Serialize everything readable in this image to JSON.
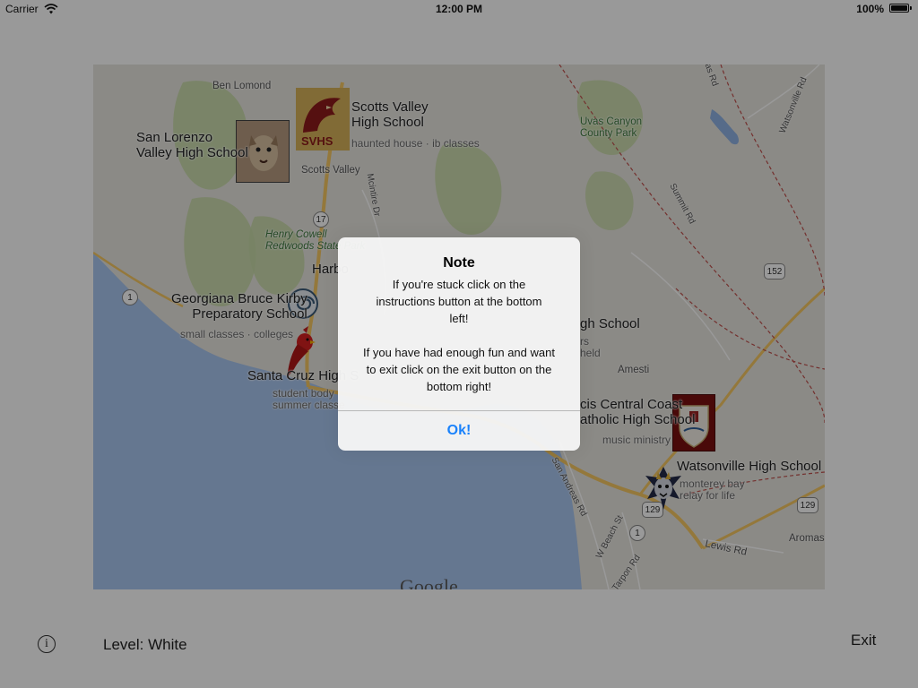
{
  "status_bar": {
    "carrier": "Carrier",
    "time": "12:00 PM",
    "battery": "100%",
    "battery_level": 1.0
  },
  "map": {
    "schools": [
      {
        "name": "San Lorenzo\nValley High School",
        "subtitle": ""
      },
      {
        "name": "Scotts Valley\nHigh School",
        "subtitle": "haunted house · ib classes"
      },
      {
        "name": "Georgiana Bruce Kirby\nPreparatory School",
        "subtitle": "small classes · colleges"
      },
      {
        "name": "Santa Cruz High S",
        "subtitle": "student body\nsummer classe"
      },
      {
        "name": "gh School",
        "subtitle": "rs\nheld"
      },
      {
        "name": "cis Central Coast\natholic High School",
        "subtitle": "music ministry"
      },
      {
        "name": "Watsonville High School",
        "subtitle": "monterey bay\nrelay for life"
      }
    ],
    "places": {
      "ben_lomond": "Ben Lomond",
      "scotts_valley": "Scotts Valley",
      "henry_cowell": "Henry Cowell\nRedwoods State Park",
      "harbor": "Harbo",
      "uvas": "Uvas Canyon\nCounty Park",
      "amesti": "Amesti",
      "aromas": "Aromas",
      "lewis_rd": "Lewis Rd",
      "san_andreas_rd": "San Andreas Rd",
      "w_beach_st": "W Beach St",
      "tarpon_rd": "Tarpon Rd",
      "summit_rd": "Summit Rd",
      "watsonville_rd": "Watsonville Rd",
      "mt_madonna": "as Rd",
      "scotts_road": "Mcintire Dr"
    },
    "routes": {
      "r17": "17",
      "r1_west": "1",
      "r1_south": "1",
      "r152": "152",
      "r129_east": "129",
      "r129_south": "129"
    },
    "google": "Google",
    "marker_labels": {
      "svhs": "SVHS"
    }
  },
  "alert": {
    "title": "Note",
    "message": "If you're stuck click on the\ninstructions button at the bottom\nleft!\n\nIf you have had enough fun and want\nto exit click on the exit button on the\nbottom right!",
    "button": "Ok!"
  },
  "bottom_bar": {
    "info_symbol": "i",
    "level": "Level: White",
    "exit": "Exit"
  },
  "colors": {
    "accent": "#1a82fb",
    "ocean": "#a9c6f0",
    "land": "#e8e6df",
    "park": "#c8dba8",
    "highway": "#f7c863"
  }
}
